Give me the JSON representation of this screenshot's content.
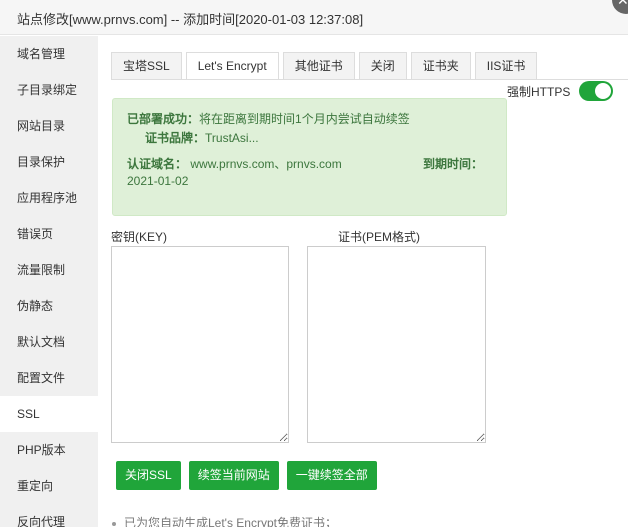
{
  "window": {
    "title": "站点修改[www.prnvs.com] -- 添加时间[2020-01-03 12:37:08]",
    "close_glyph": "✕"
  },
  "sidebar": {
    "items": [
      {
        "label": "域名管理"
      },
      {
        "label": "子目录绑定"
      },
      {
        "label": "网站目录"
      },
      {
        "label": "目录保护"
      },
      {
        "label": "应用程序池"
      },
      {
        "label": "错误页"
      },
      {
        "label": "流量限制"
      },
      {
        "label": "伪静态"
      },
      {
        "label": "默认文档"
      },
      {
        "label": "配置文件"
      },
      {
        "label": "SSL",
        "active": true
      },
      {
        "label": "PHP版本"
      },
      {
        "label": "重定向"
      },
      {
        "label": "反向代理"
      }
    ]
  },
  "tabs": {
    "items": [
      {
        "label": "宝塔SSL"
      },
      {
        "label": "Let's Encrypt",
        "active": true
      },
      {
        "label": "其他证书"
      },
      {
        "label": "关闭"
      },
      {
        "label": "证书夹"
      },
      {
        "label": "IIS证书"
      }
    ]
  },
  "https": {
    "label": "强制HTTPS",
    "enabled": true,
    "accent": "#20a53a"
  },
  "status": {
    "deployed_label": "已部署成功：",
    "deployed_text": "将在距离到期时间1个月内尝试自动续签",
    "brand_label": "证书品牌：",
    "brand_value": "TrustAsi...",
    "domain_label": "认证域名：",
    "domain_value": "www.prnvs.com、prnvs.com",
    "expire_label": "到期时间：",
    "expire_value": "2021-01-02"
  },
  "fields": {
    "key_label": "密钥(KEY)",
    "cert_label": "证书(PEM格式)",
    "key_value": "",
    "cert_value": ""
  },
  "buttons": {
    "close_ssl": "关闭SSL",
    "renew_current": "续签当前网站",
    "renew_all": "一键续签全部"
  },
  "note": {
    "text": "已为您自动生成Let's Encrypt免费证书；"
  }
}
